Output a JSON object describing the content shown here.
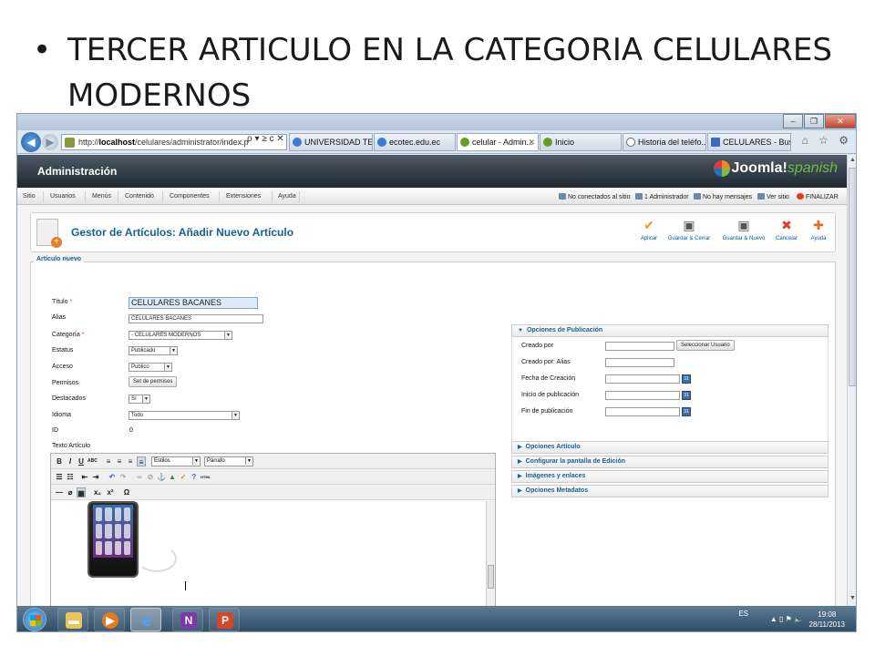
{
  "slide": {
    "bullet_symbol": "•",
    "bullet_text": "TERCER ARTICULO EN LA CATEGORIA CELULARES MODERNOS"
  },
  "browser": {
    "window_controls": [
      "–",
      "❐",
      "✕"
    ],
    "url_prefix": "http://",
    "url_host": "localhost",
    "url_path": "/celulares/administrator/index.p",
    "url_tools": "ρ ▾ ≥ c ✕",
    "tabs": [
      {
        "label": "UNIVERSIDAD TEC...",
        "active": false
      },
      {
        "label": "ecotec.edu.ec",
        "active": false
      },
      {
        "label": "celular - Admin...",
        "active": true
      },
      {
        "label": "Inicio",
        "active": false
      },
      {
        "label": "Historia del teléfo...",
        "active": false
      },
      {
        "label": "CELULARES - Busc...",
        "active": false
      }
    ],
    "tool_icons": "⌂ ☆ ⚙"
  },
  "joomla": {
    "header_title": "Administración",
    "logo_text": "Joomla!",
    "logo_sub": "spanish",
    "menu": [
      "Sitio",
      "Usuarios",
      "Menús",
      "Contenido",
      "Componentes",
      "Extensiones",
      "Ayuda"
    ],
    "status": {
      "visitors": "No conectados al sitio",
      "admins": "1 Administrador",
      "messages": "No hay mensajes",
      "view_site": "Ver sitio",
      "logout": "FINALIZAR"
    },
    "page_title": "Gestor de Artículos: Añadir Nuevo Artículo",
    "toolbar": [
      {
        "label": "Aplicar",
        "icon": "✔",
        "color": "#e69a1f"
      },
      {
        "label": "Guardar & Cerrar",
        "icon": "▣",
        "color": "#555555"
      },
      {
        "label": "Guardar & Nuevo",
        "icon": "▣",
        "color": "#555555"
      },
      {
        "label": "Cancelar",
        "icon": "✖",
        "color": "#d9412b"
      },
      {
        "label": "Ayuda",
        "icon": "✚",
        "color": "#e2701f"
      }
    ]
  },
  "form": {
    "legend": "Artículo nuevo",
    "title_label": "Título",
    "title_value": "CELULARES BACANES",
    "alias_label": "Alias",
    "alias_value": "CELULARES BACANES",
    "category_label": "Categoría",
    "category_value": "- CELULARES MODERNOS",
    "status_label": "Estatus",
    "status_value": "Publicado",
    "access_label": "Acceso",
    "access_value": "Publico",
    "perms_label": "Permisos",
    "perms_button": "Set de permisos",
    "featured_label": "Destacados",
    "featured_value": "Sí",
    "language_label": "Idioma",
    "language_value": "Todo",
    "id_label": "ID",
    "id_value": "0",
    "text_label": "Texto Artículo",
    "required_mark": "*"
  },
  "editor": {
    "styles_value": "Estilos",
    "format_value": "Párrafo"
  },
  "publishing": {
    "header": "Opciones de Publicación",
    "created_by": "Creado por",
    "select_user": "Seleccionar Usuario",
    "created_alias": "Creado por: Alias",
    "created_date": "Fecha de Creación",
    "publish_up": "Inicio de publicación",
    "publish_down": "Fin de publicación",
    "calendar_glyph": "31",
    "sections": [
      "Opciones Artículo",
      "Configurar la pantalla de Edición",
      "Imágenes y enlaces",
      "Opciones Metadatos"
    ]
  },
  "taskbar": {
    "lang": "ES",
    "tray_icons": "▲ ▯ ⚑ 🔈",
    "time": "19:08",
    "date": "28/11/2013"
  }
}
